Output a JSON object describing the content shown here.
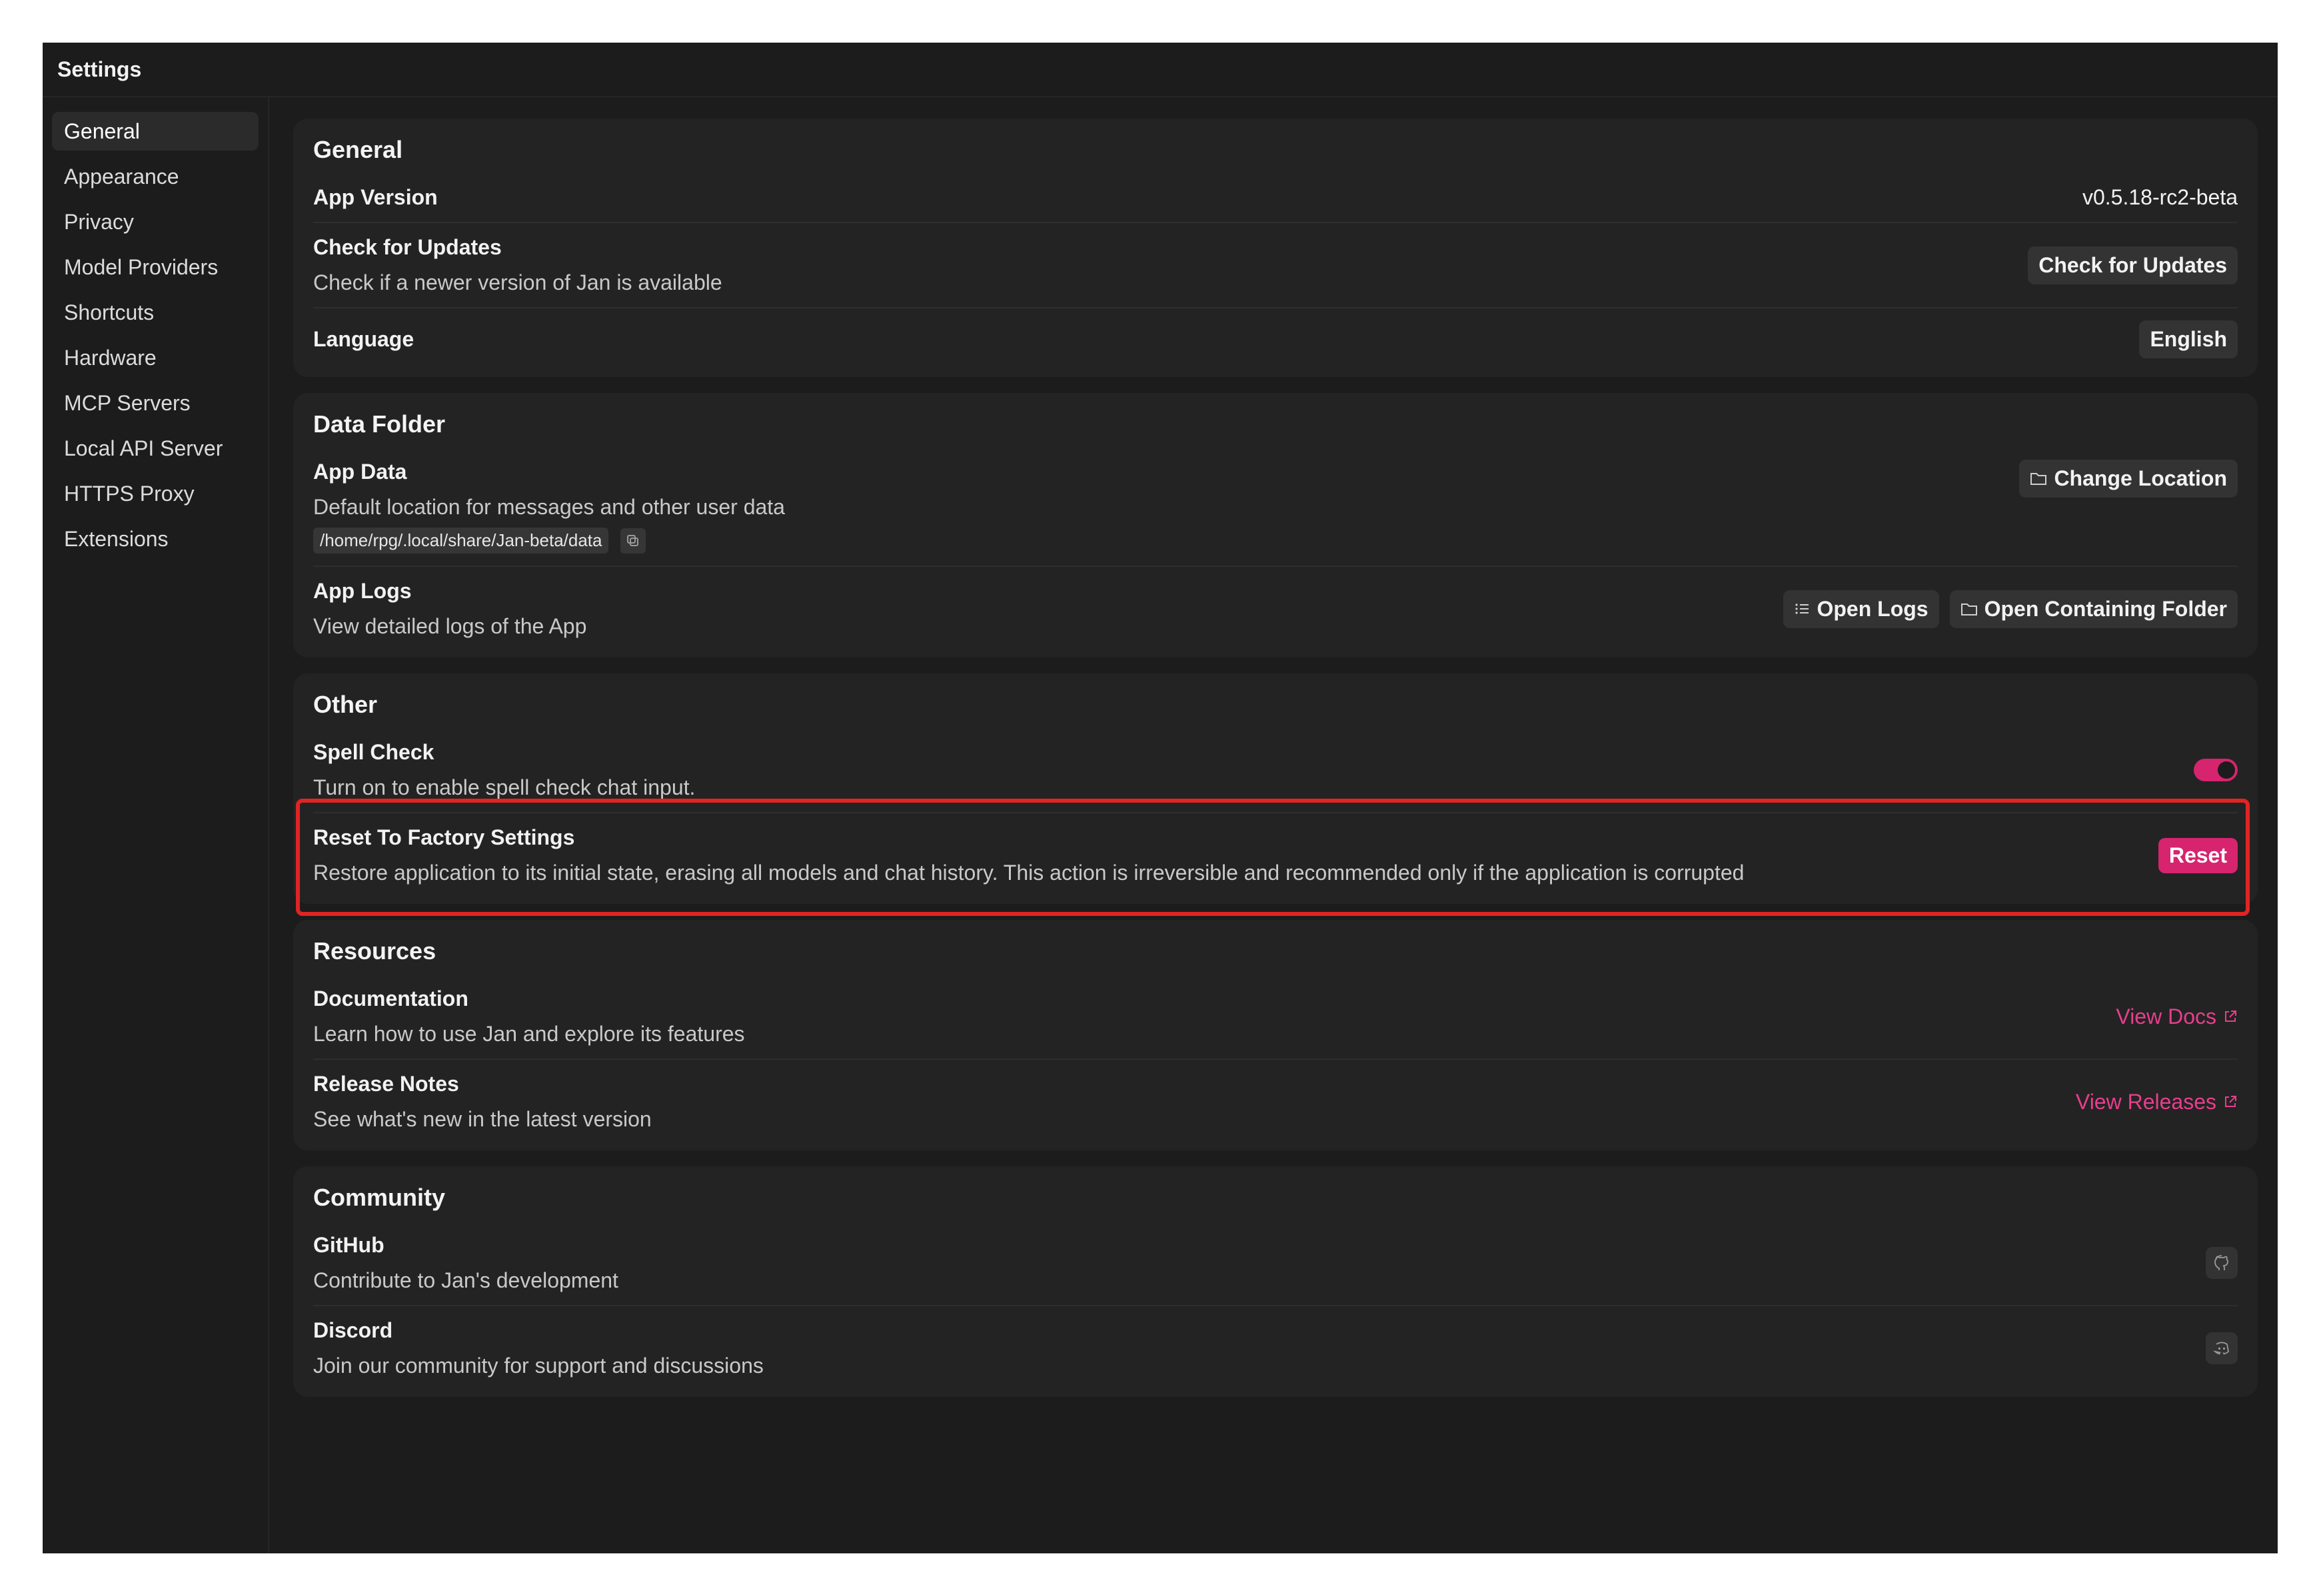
{
  "window": {
    "title": "Settings"
  },
  "sidebar": {
    "items": [
      {
        "label": "General",
        "active": true
      },
      {
        "label": "Appearance"
      },
      {
        "label": "Privacy"
      },
      {
        "label": "Model Providers"
      },
      {
        "label": "Shortcuts"
      },
      {
        "label": "Hardware"
      },
      {
        "label": "MCP Servers"
      },
      {
        "label": "Local API Server"
      },
      {
        "label": "HTTPS Proxy"
      },
      {
        "label": "Extensions"
      }
    ]
  },
  "general": {
    "title": "General",
    "app_version": {
      "title": "App Version",
      "value": "v0.5.18-rc2-beta"
    },
    "check_updates": {
      "title": "Check for Updates",
      "desc": "Check if a newer version of Jan is available",
      "button": "Check for Updates"
    },
    "language": {
      "title": "Language",
      "value": "English"
    }
  },
  "data_folder": {
    "title": "Data Folder",
    "app_data": {
      "title": "App Data",
      "desc": "Default location for messages and other user data",
      "path": "/home/rpg/.local/share/Jan-beta/data",
      "button": "Change Location"
    },
    "app_logs": {
      "title": "App Logs",
      "desc": "View detailed logs of the App",
      "open_logs": "Open Logs",
      "open_folder": "Open Containing Folder"
    }
  },
  "other": {
    "title": "Other",
    "spell_check": {
      "title": "Spell Check",
      "desc": "Turn on to enable spell check chat input.",
      "enabled": true
    },
    "reset": {
      "title": "Reset To Factory Settings",
      "desc": "Restore application to its initial state, erasing all models and chat history. This action is irreversible and recommended only if the application is corrupted",
      "button": "Reset"
    }
  },
  "resources": {
    "title": "Resources",
    "docs": {
      "title": "Documentation",
      "desc": "Learn how to use Jan and explore its features",
      "link": "View Docs"
    },
    "release": {
      "title": "Release Notes",
      "desc": "See what's new in the latest version",
      "link": "View Releases"
    }
  },
  "community": {
    "title": "Community",
    "github": {
      "title": "GitHub",
      "desc": "Contribute to Jan's development"
    },
    "discord": {
      "title": "Discord",
      "desc": "Join our community for support and discussions"
    }
  },
  "colors": {
    "accent": "#e83e8c",
    "danger": "#d6246e",
    "highlight": "#e02424",
    "background": "#1c1c1c",
    "card": "#232323"
  }
}
